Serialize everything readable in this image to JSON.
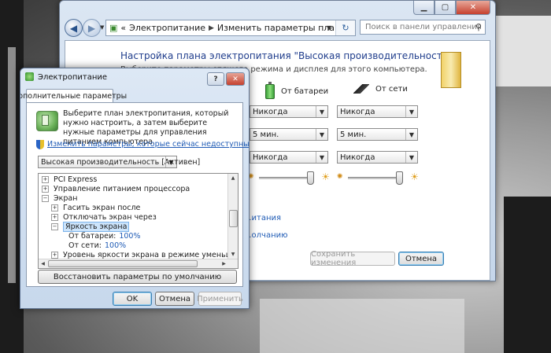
{
  "main_window": {
    "address": {
      "prefix": "«",
      "crumb1": "Электропитание",
      "crumb2": "Изменить параметры плана"
    },
    "search_placeholder": "Поиск в панели управления",
    "title": "Настройка плана электропитания \"Высокая производительность\"",
    "subtitle": "Выберите параметры спящего режима и дисплея для этого компьютера.",
    "columns": {
      "battery": "От батареи",
      "ac": "От сети"
    },
    "rows": [
      {
        "battery": "Никогда",
        "ac": "Никогда"
      },
      {
        "battery": "5 мин.",
        "ac": "5 мин."
      },
      {
        "battery": "Никогда",
        "ac": "Никогда"
      }
    ],
    "brightness": {
      "battery": 0.95,
      "ac": 0.95
    },
    "links": [
      "...итания",
      "...олчанию"
    ],
    "save_button": "Сохранить изменения",
    "cancel_button": "Отмена"
  },
  "dialog": {
    "title": "Электропитание",
    "tab": "Дополнительные параметры",
    "intro": "Выберите план электропитания, который нужно настроить, а затем выберите нужные параметры для управления питанием компьютера.",
    "change_link": "Изменить параметры, которые сейчас недоступны",
    "plan": "Высокая производительность [Активен]",
    "tree": {
      "pci": "PCI Express",
      "cpu": "Управление питанием процессора",
      "screen": "Экран",
      "dim_after": "Гасить экран после",
      "turn_off": "Отключать экран через",
      "brightness": "Яркость экрана",
      "on_battery_label": "От батареи:",
      "on_battery_value": "100%",
      "on_ac_label": "От сети:",
      "on_ac_value": "100%",
      "dimmed": "Уровень яркости экрана в режиме уменьшенной яр"
    },
    "restore_button": "Восстановить параметры по умолчанию",
    "ok_button": "OK",
    "cancel_button": "Отмена",
    "apply_button": "Применить"
  }
}
